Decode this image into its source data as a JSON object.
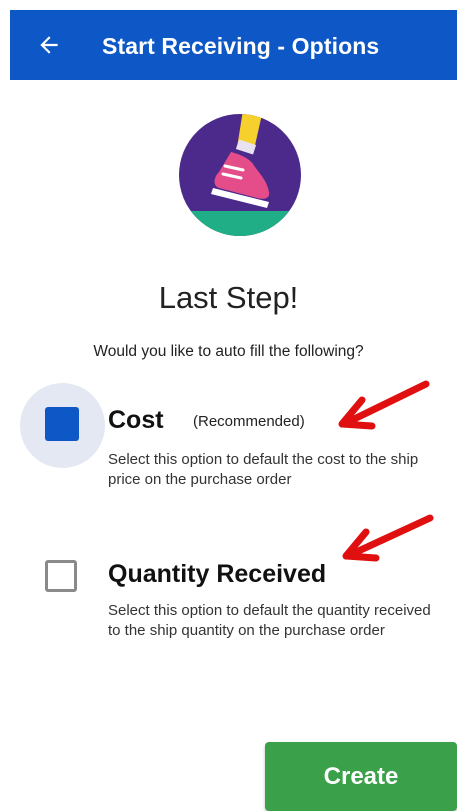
{
  "header": {
    "title": "Start Receiving - Options",
    "back_icon": "arrow-left-icon"
  },
  "main": {
    "heading": "Last Step!",
    "subheading": "Would you like to auto fill the following?",
    "options": [
      {
        "title": "Cost",
        "tag": "(Recommended)",
        "description": "Select this option to default the cost to the ship price on the purchase order",
        "checked": true
      },
      {
        "title": "Quantity Received",
        "description": "Select this option to default the quantity received to the ship quantity on the purchase order",
        "checked": false
      }
    ]
  },
  "actions": {
    "create_label": "Create"
  },
  "colors": {
    "appbar": "#0d57c7",
    "checkbox": "#0d57c7",
    "create_button": "#3aa04a",
    "annotation_arrow": "#e01010"
  }
}
